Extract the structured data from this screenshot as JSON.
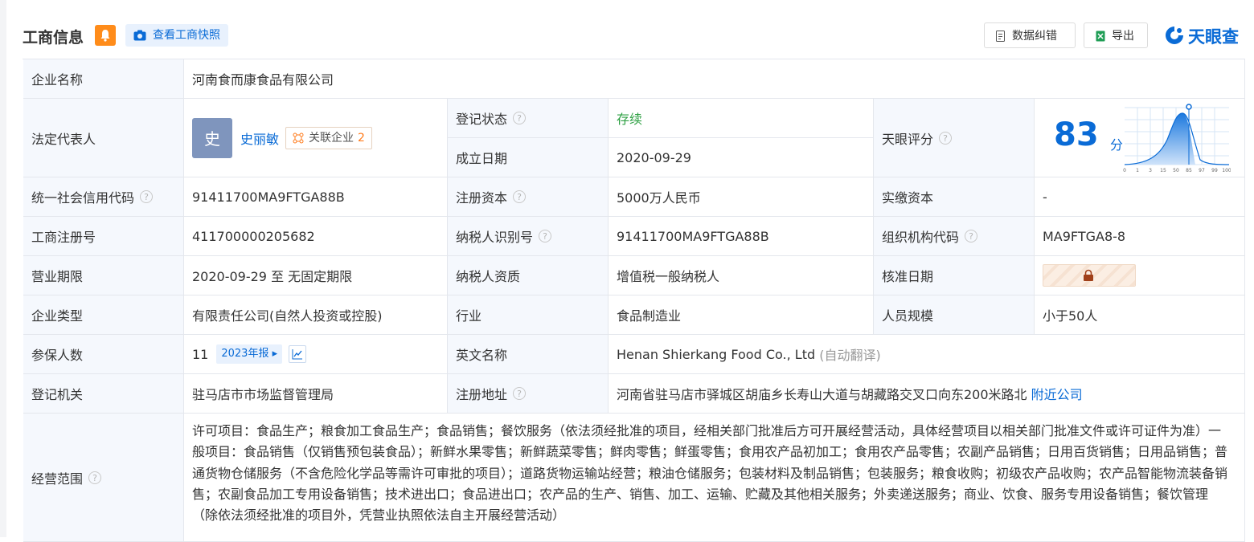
{
  "header": {
    "title": "工商信息",
    "snapshot_label": "查看工商快照",
    "correct_label": "数据纠错",
    "export_label": "导出",
    "logo_text": "天眼查"
  },
  "company_name": {
    "label": "企业名称",
    "value": "河南食而康食品有限公司"
  },
  "legal_rep": {
    "label": "法定代表人",
    "avatar_char": "史",
    "name": "史丽敏",
    "assoc_label": "关联企业",
    "assoc_count": "2"
  },
  "reg_status": {
    "label": "登记状态",
    "value": "存续"
  },
  "found_date": {
    "label": "成立日期",
    "value": "2020-09-29"
  },
  "tianyan_score": {
    "label": "天眼评分",
    "value": "83",
    "unit": "分",
    "axis_ticks": [
      "0",
      "1",
      "3",
      "15",
      "50",
      "85",
      "97",
      "99",
      "100"
    ]
  },
  "credit_code": {
    "label": "统一社会信用代码",
    "value": "91411700MA9FTGA88B"
  },
  "reg_capital": {
    "label": "注册资本",
    "value": "5000万人民币"
  },
  "paid_capital": {
    "label": "实缴资本",
    "value": "-"
  },
  "reg_number": {
    "label": "工商注册号",
    "value": "411700000205682"
  },
  "taxpayer_id": {
    "label": "纳税人识别号",
    "value": "91411700MA9FTGA88B"
  },
  "org_code": {
    "label": "组织机构代码",
    "value": "MA9FTGA8-8"
  },
  "biz_term": {
    "label": "营业期限",
    "value": "2020-09-29 至 无固定期限"
  },
  "taxpayer_quality": {
    "label": "纳税人资质",
    "value": "增值税一般纳税人"
  },
  "approval_date": {
    "label": "核准日期"
  },
  "company_type": {
    "label": "企业类型",
    "value": "有限责任公司(自然人投资或控股)"
  },
  "industry": {
    "label": "行业",
    "value": "食品制造业"
  },
  "staff_size": {
    "label": "人员规模",
    "value": "小于50人"
  },
  "insured": {
    "label": "参保人数",
    "value": "11",
    "report_label": "2023年报"
  },
  "english_name": {
    "label": "英文名称",
    "value": "Henan Shierkang Food Co., Ltd",
    "note": "(自动翻译)"
  },
  "reg_authority": {
    "label": "登记机关",
    "value": "驻马店市市场监督管理局"
  },
  "reg_address": {
    "label": "注册地址",
    "value": "河南省驻马店市驿城区胡庙乡长寿山大道与胡藏路交叉口向东200米路北",
    "nearby_label": "附近公司"
  },
  "biz_scope": {
    "label": "经营范围",
    "value": "许可项目：食品生产；粮食加工食品生产；食品销售；餐饮服务（依法须经批准的项目，经相关部门批准后方可开展经营活动，具体经营项目以相关部门批准文件或许可证件为准）一般项目：食品销售（仅销售预包装食品）；新鲜水果零售；新鲜蔬菜零售；鲜肉零售；鲜蛋零售；食用农产品初加工；食用农产品零售；农副产品销售；日用百货销售；日用品销售；普通货物仓储服务（不含危险化学品等需许可审批的项目）；道路货物运输站经营；粮油仓储服务；包装材料及制品销售；包装服务；粮食收购；初级农产品收购；农产品智能物流装备销售；农副食品加工专用设备销售；技术进出口；食品进出口；农产品的生产、销售、加工、运输、贮藏及其他相关服务；外卖递送服务；商业、饮食、服务专用设备销售；餐饮管理（除依法须经批准的项目外，凭营业执照依法自主开展经营活动）"
  },
  "colors": {
    "accent": "#0a6bd6",
    "label_bg": "#f5f8fd",
    "status_green": "#2ea043",
    "orange": "#ff8c1a"
  }
}
